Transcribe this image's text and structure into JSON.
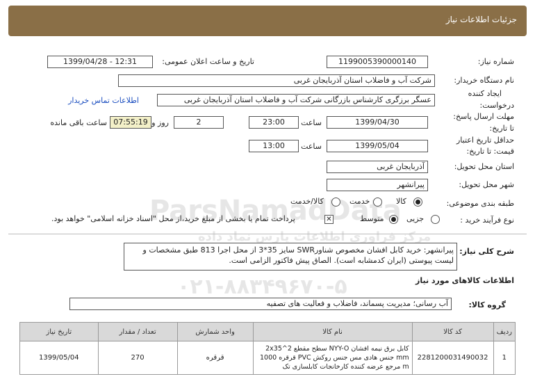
{
  "header": {
    "title": "جزئیات اطلاعات نیاز"
  },
  "fields": {
    "need_number_label": "شماره نیاز:",
    "need_number": "1199005390000140",
    "announce_label": "تاریخ و ساعت اعلان عمومی:",
    "announce_value": "1399/04/28 - 12:31",
    "buyer_label": "نام دستگاه خریدار:",
    "buyer_value": "شرکت آب و فاضلاب استان آذربایجان غربی",
    "creator_label_1": "ایجاد کننده",
    "creator_label_2": "درخواست:",
    "creator_value": "عسگر  برزگری کارشناس بازرگانی شرکت آب و فاضلاب استان آذربایجان غربی",
    "contact_link": "اطلاعات تماس خریدار",
    "deadline_label_1": "مهلت ارسال پاسخ:",
    "deadline_label_2": "تا تاریخ:",
    "deadline_date": "1399/04/30",
    "time_label": "ساعت",
    "deadline_time": "23:00",
    "days_value": "2",
    "days_label": "روز و",
    "remaining_time": "07:55:19",
    "remaining_label": "ساعت باقی مانده",
    "validity_label_1": "حداقل تاریخ اعتبار",
    "validity_label_2": "قیمت: تا تاریخ:",
    "validity_date": "1399/05/04",
    "validity_time_label": "ساعت",
    "validity_time": "13:00",
    "province_label": "استان محل تحویل:",
    "province_value": "آذربایجان غربی",
    "city_label": "شهر محل تحویل:",
    "city_value": "پیرانشهر",
    "category_label": "طبقه بندی موضوعی:",
    "category_options": [
      "کالا",
      "خدمت",
      "کالا/خدمت"
    ],
    "process_label": "نوع فرآیند خرید :",
    "process_options": [
      "جزیی",
      "متوسط"
    ],
    "payment_note": "پرداخت تمام یا بخشی از مبلغ خرید،از محل \"اسناد خزانه اسلامی\" خواهد بود."
  },
  "description": {
    "label": "شرح کلی نیاز:",
    "text": "پیرانشهر: خرید کابل افشان مخصوص شناورSWR سایز 35*3 از محل اجرا 813 طبق مشخصات و لیست پیوستی (ایران کدمشابه است). الصاق پیش فاکتور الزامی است."
  },
  "goods_section": {
    "title": "اطلاعات کالاهای مورد نیاز",
    "group_label": "گروه کالا:",
    "group_value": "آب رسانی؛ مدیریت پسماند، فاضلاب و فعالیت های تصفیه"
  },
  "table": {
    "headers": [
      "ردیف",
      "کد کالا",
      "نام کالا",
      "واحد شمارش",
      "تعداد / مقدار",
      "تاریخ نیاز"
    ],
    "rows": [
      {
        "row": "1",
        "code": "2281200031490032",
        "name": "کابل برق نیمه افشان NYY-O سطح مقطع 2^2x35 mm جنس هادی مس جنس روکش PVC قرقره 1000 m مرجع عرضه کننده کارخانجات کابلسازی تک",
        "unit": "قرقره",
        "qty": "270",
        "date": "1399/05/04"
      }
    ]
  },
  "watermark": {
    "brand": "ParsNamadData",
    "line1": "مرکز فراوری اطلاعات پارس نماد داده",
    "line2": "پایگاه اطلاعات مناقصه و مزایده",
    "phone": "۰۲۱-۸۸۳۴۹۶۷۰-۵"
  }
}
